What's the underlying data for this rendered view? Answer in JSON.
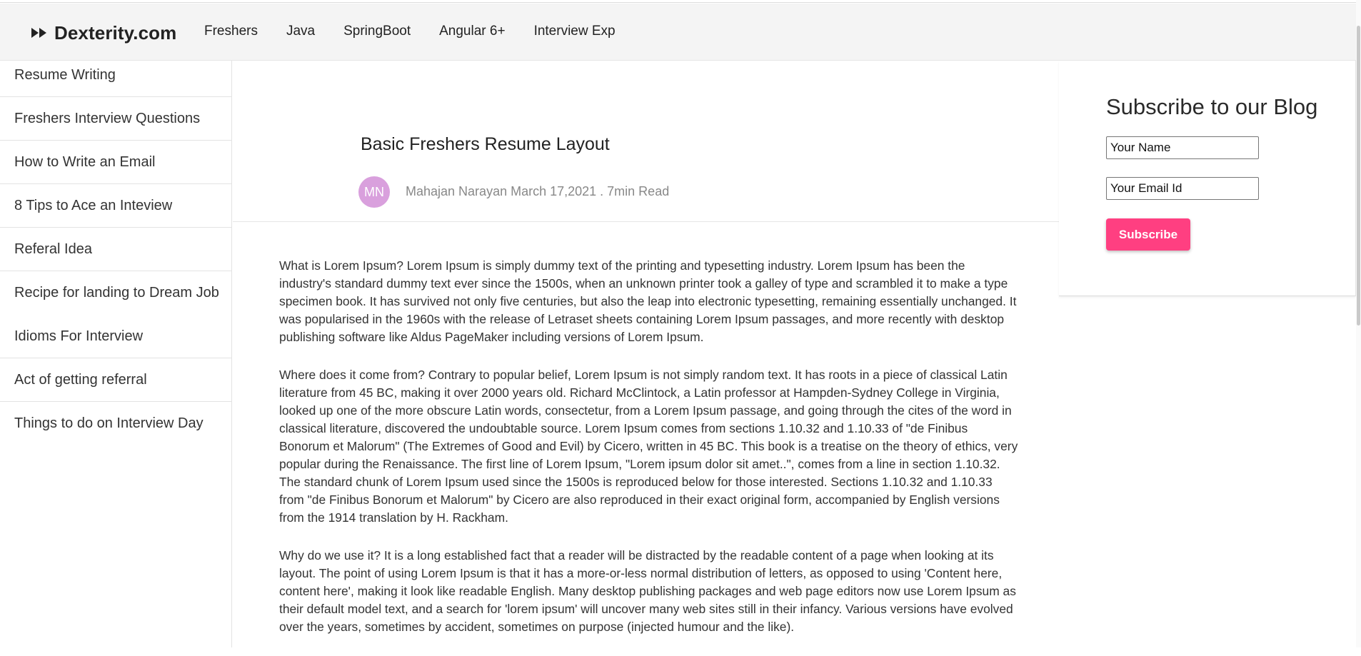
{
  "navbar": {
    "brand": "Dexterity.com",
    "brand_icon": "fast-forward-icon",
    "links": [
      "Freshers",
      "Java",
      "SpringBoot",
      "Angular 6+",
      "Interview Exp"
    ]
  },
  "sidebar": {
    "items": [
      "Resume Writing",
      "Freshers Interview Questions",
      "How to Write an Email",
      "8 Tips to Ace an Inteview",
      "Referal Idea",
      "Recipe for landing to Dream Job",
      "Idioms For Interview",
      "Act of getting referral",
      "Things to do on Interview Day"
    ]
  },
  "post": {
    "title": "Basic Freshers Resume Layout",
    "avatar_initials": "MN",
    "avatar_color": "#d9a0dd",
    "meta": "Mahajan Narayan March 17,2021 . 7min Read",
    "paragraphs": [
      "What is Lorem Ipsum? Lorem Ipsum is simply dummy text of the printing and typesetting industry. Lorem Ipsum has been the industry's standard dummy text ever since the 1500s, when an unknown printer took a galley of type and scrambled it to make a type specimen book. It has survived not only five centuries, but also the leap into electronic typesetting, remaining essentially unchanged. It was popularised in the 1960s with the release of Letraset sheets containing Lorem Ipsum passages, and more recently with desktop publishing software like Aldus PageMaker including versions of Lorem Ipsum.",
      "Where does it come from? Contrary to popular belief, Lorem Ipsum is not simply random text. It has roots in a piece of classical Latin literature from 45 BC, making it over 2000 years old. Richard McClintock, a Latin professor at Hampden-Sydney College in Virginia, looked up one of the more obscure Latin words, consectetur, from a Lorem Ipsum passage, and going through the cites of the word in classical literature, discovered the undoubtable source. Lorem Ipsum comes from sections 1.10.32 and 1.10.33 of \"de Finibus Bonorum et Malorum\" (The Extremes of Good and Evil) by Cicero, written in 45 BC. This book is a treatise on the theory of ethics, very popular during the Renaissance. The first line of Lorem Ipsum, \"Lorem ipsum dolor sit amet..\", comes from a line in section 1.10.32. The standard chunk of Lorem Ipsum used since the 1500s is reproduced below for those interested. Sections 1.10.32 and 1.10.33 from \"de Finibus Bonorum et Malorum\" by Cicero are also reproduced in their exact original form, accompanied by English versions from the 1914 translation by H. Rackham.",
      "Why do we use it? It is a long established fact that a reader will be distracted by the readable content of a page when looking at its layout. The point of using Lorem Ipsum is that it has a more-or-less normal distribution of letters, as opposed to using 'Content here, content here', making it look like readable English. Many desktop publishing packages and web page editors now use Lorem Ipsum as their default model text, and a search for 'lorem ipsum' will uncover many web sites still in their infancy. Various versions have evolved over the years, sometimes by accident, sometimes on purpose (injected humour and the like)."
    ]
  },
  "subscribe": {
    "title": "Subscribe to our Blog",
    "name_placeholder": "Your Name",
    "email_placeholder": "Your Email Id",
    "button_label": "Subscribe",
    "button_color": "#ff3f81"
  }
}
